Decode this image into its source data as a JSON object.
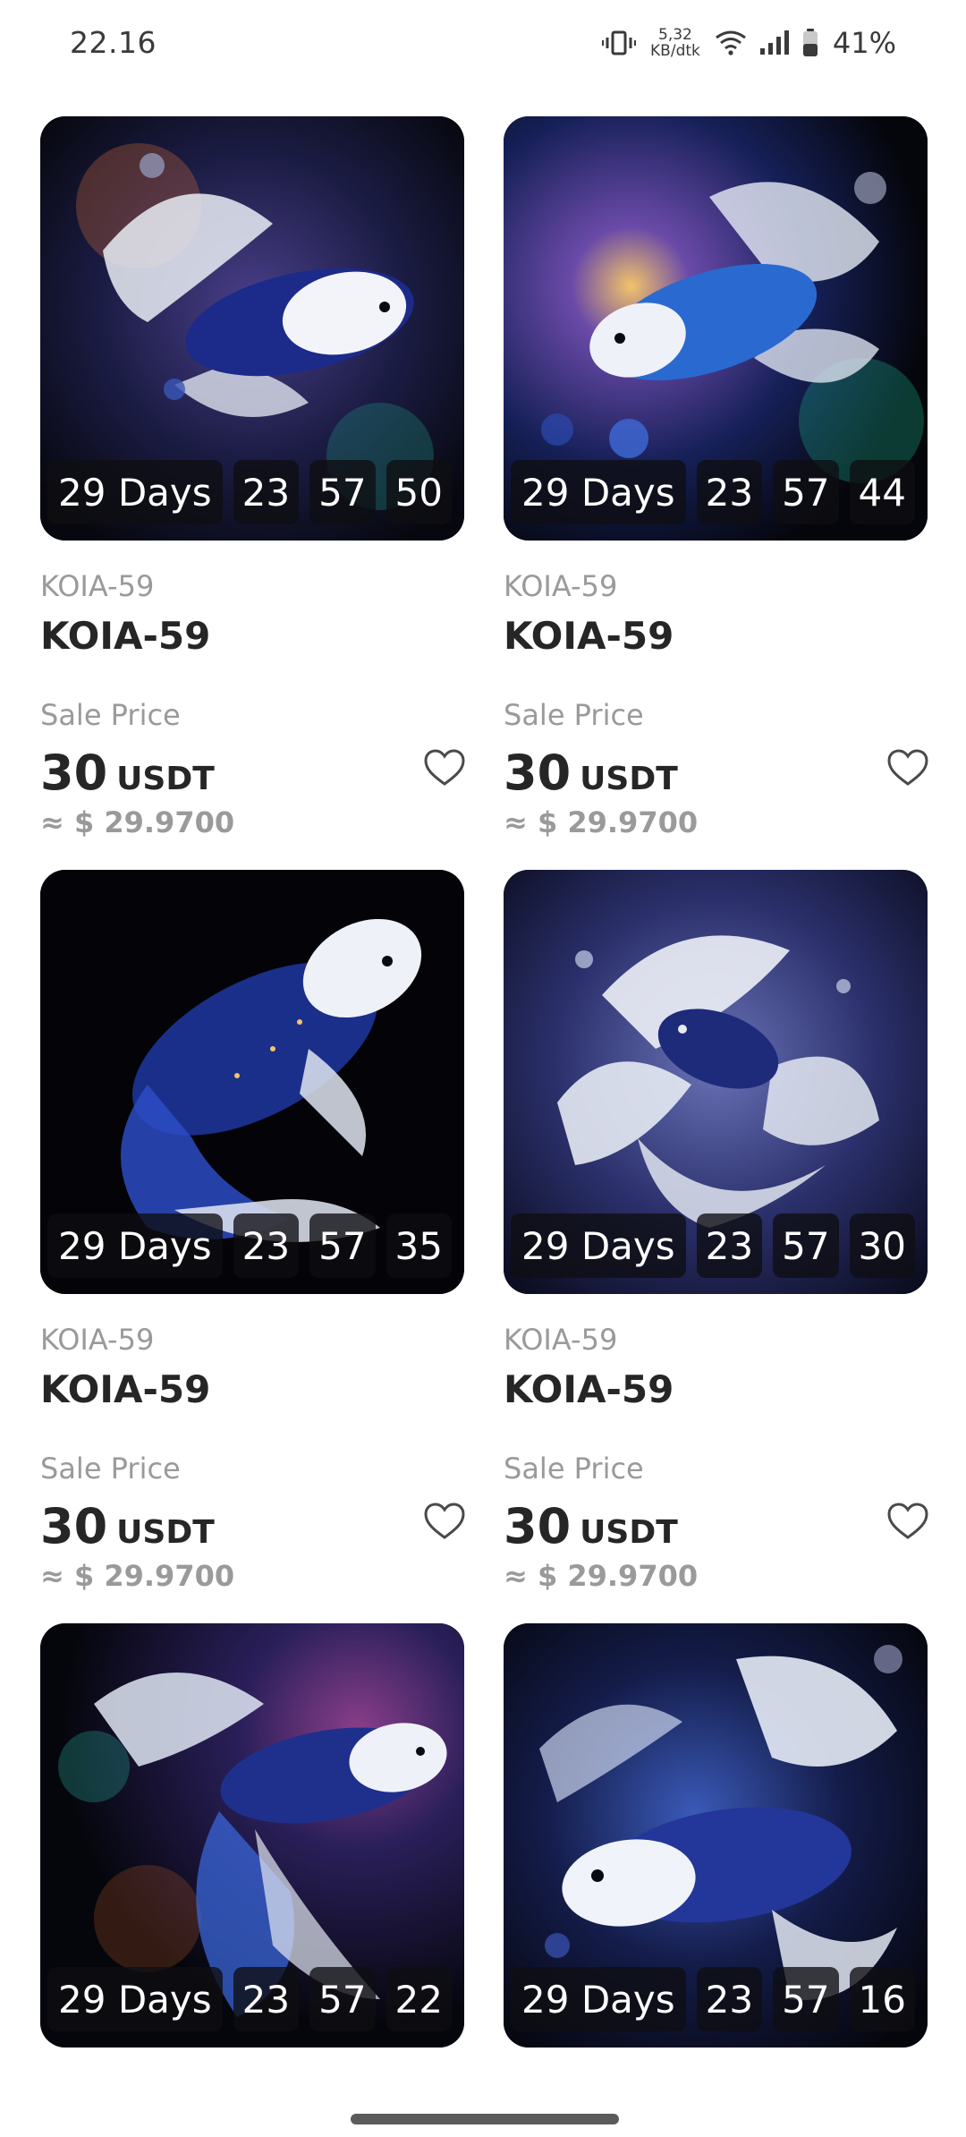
{
  "status_bar": {
    "time": "22.16",
    "net_speed_value": "5,32",
    "net_speed_unit": "KB/dtk",
    "battery": "41%"
  },
  "products": [
    {
      "subtitle": "KOIA-59",
      "title": "KOIA-59",
      "price_label": "Sale Price",
      "price": "30",
      "currency": "USDT",
      "approx": "≈ $ 29.9700",
      "countdown": {
        "days": "29 Days",
        "hours": "23",
        "minutes": "57",
        "seconds": "50"
      },
      "image_icon": "koi-fish-artwork"
    },
    {
      "subtitle": "KOIA-59",
      "title": "KOIA-59",
      "price_label": "Sale Price",
      "price": "30",
      "currency": "USDT",
      "approx": "≈ $ 29.9700",
      "countdown": {
        "days": "29 Days",
        "hours": "23",
        "minutes": "57",
        "seconds": "44"
      },
      "image_icon": "koi-fish-artwork"
    },
    {
      "subtitle": "KOIA-59",
      "title": "KOIA-59",
      "price_label": "Sale Price",
      "price": "30",
      "currency": "USDT",
      "approx": "≈ $ 29.9700",
      "countdown": {
        "days": "29 Days",
        "hours": "23",
        "minutes": "57",
        "seconds": "35"
      },
      "image_icon": "koi-fish-artwork"
    },
    {
      "subtitle": "KOIA-59",
      "title": "KOIA-59",
      "price_label": "Sale Price",
      "price": "30",
      "currency": "USDT",
      "approx": "≈ $ 29.9700",
      "countdown": {
        "days": "29 Days",
        "hours": "23",
        "minutes": "57",
        "seconds": "30"
      },
      "image_icon": "koi-fish-artwork"
    },
    {
      "countdown": {
        "days": "29 Days",
        "hours": "23",
        "minutes": "57",
        "seconds": "22"
      },
      "image_icon": "koi-fish-artwork"
    },
    {
      "countdown": {
        "days": "29 Days",
        "hours": "23",
        "minutes": "57",
        "seconds": "16"
      },
      "image_icon": "koi-fish-artwork"
    }
  ],
  "colors": {
    "text_primary": "#262626",
    "text_secondary": "#9a9a9a",
    "image_background": "#06070e",
    "countdown_box": "#0e0e12"
  }
}
